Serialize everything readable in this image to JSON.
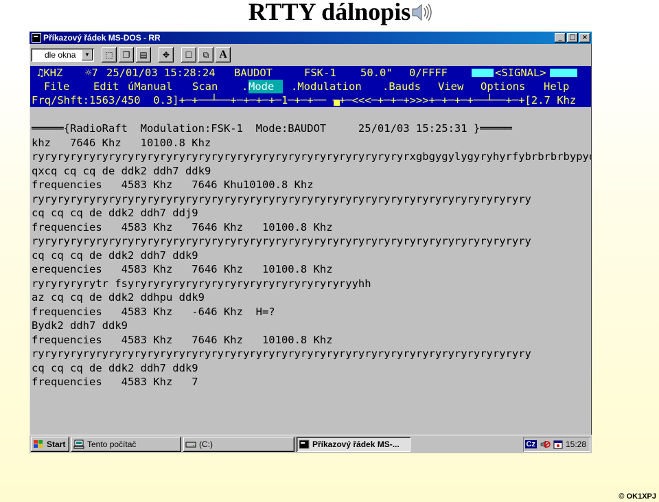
{
  "slide": {
    "title": "RTTY dálnopis",
    "copyright": "© OK1XPJ",
    "speaker_icon": "speaker-icon"
  },
  "window": {
    "title": "Příkazový řádek MS-DOS - RR",
    "buttons": {
      "minimize": "_",
      "maximize": "□",
      "close": "×"
    },
    "toolbar": {
      "font_size_value": "dle okna",
      "font_button_label": "A"
    }
  },
  "console": {
    "status": {
      "khz": "♫KHZ",
      "num": "☼7",
      "datetime": "25/01/03 15:28:24",
      "code": "BAUDOT",
      "modulation": "FSK-1",
      "baud": "50.0\"",
      "hex": "0/FFFF",
      "signal": "<SIGNAL>"
    },
    "menu": [
      {
        "label": "File"
      },
      {
        "label": "Edit"
      },
      {
        "label": "úManual"
      },
      {
        "label": "Scan"
      },
      {
        "label": ".Mode",
        "prefix": ".",
        "active_part": "Mode"
      },
      {
        "label": ".Modulation"
      },
      {
        "label": ".Bauds"
      },
      {
        "label": "View"
      },
      {
        "label": "Options"
      },
      {
        "label": "Help"
      }
    ],
    "freq_line": "Frq/Shft:1563/450  0.3]+─+──┴──+─+─+─+─1─+─+── ─+─<<<─+─+─+>>>+─+─+─+──┴──+─+[2.7 Khz",
    "lines": [
      "═════{RadioRaft  Modulation:FSK-1  Mode:BAUDOT     25/01/03 15:25:31 }═════",
      "khz   7646 Khz   10100.8 Khz",
      "ryryryryryryryryryryryryryryryryryryryryryryryryryryryryryrxgbgygylygyryhyrfybrbrbrbypyq",
      "qxcq cq cq de ddk2 ddh7 ddk9",
      "frequencies   4583 Khz   7646 Khu10100.8 Khz",
      "ryryryryryryryryryryryryryryryryryryryryryryryryryryryryryryryryryryryryryryry",
      "cq cq cq de ddk2 ddh7 ddj9",
      "frequencies   4583 Khz   7646 Khz   10100.8 Khz",
      "ryryryryryryryryryryryryryryryryryryryryryryryryryryryryryryryryryryryryryryry",
      "cq cq cq de ddk2 ddh7 ddk9",
      "erequencies   4583 Khz   7646 Khz   10100.8 Khz",
      "ryryryryrytr fsyryryryryryryryryryryryryryryryryryyhh",
      "az cq cq de ddk2 ddhpu ddk9",
      "frequencies   4583 Khz   -646 Khz  H=?",
      "Bydk2 ddh7 ddk9",
      "frequencies   4583 Khz   7646 Khz   10100.8 Khz",
      "ryryryryryryryryryryryryryryryryryryryryryryryryryryryryryryryryryryryryryryry",
      "cq cq cq de ddk2 ddh7 ddk9",
      "frequencies   4583 Khz   7"
    ]
  },
  "taskbar": {
    "start": "Start",
    "tasks": [
      "Tento počítač",
      "(C:)",
      "Příkazový řádek MS-..."
    ],
    "tray_lang": "Cz",
    "clock": "15:28"
  }
}
